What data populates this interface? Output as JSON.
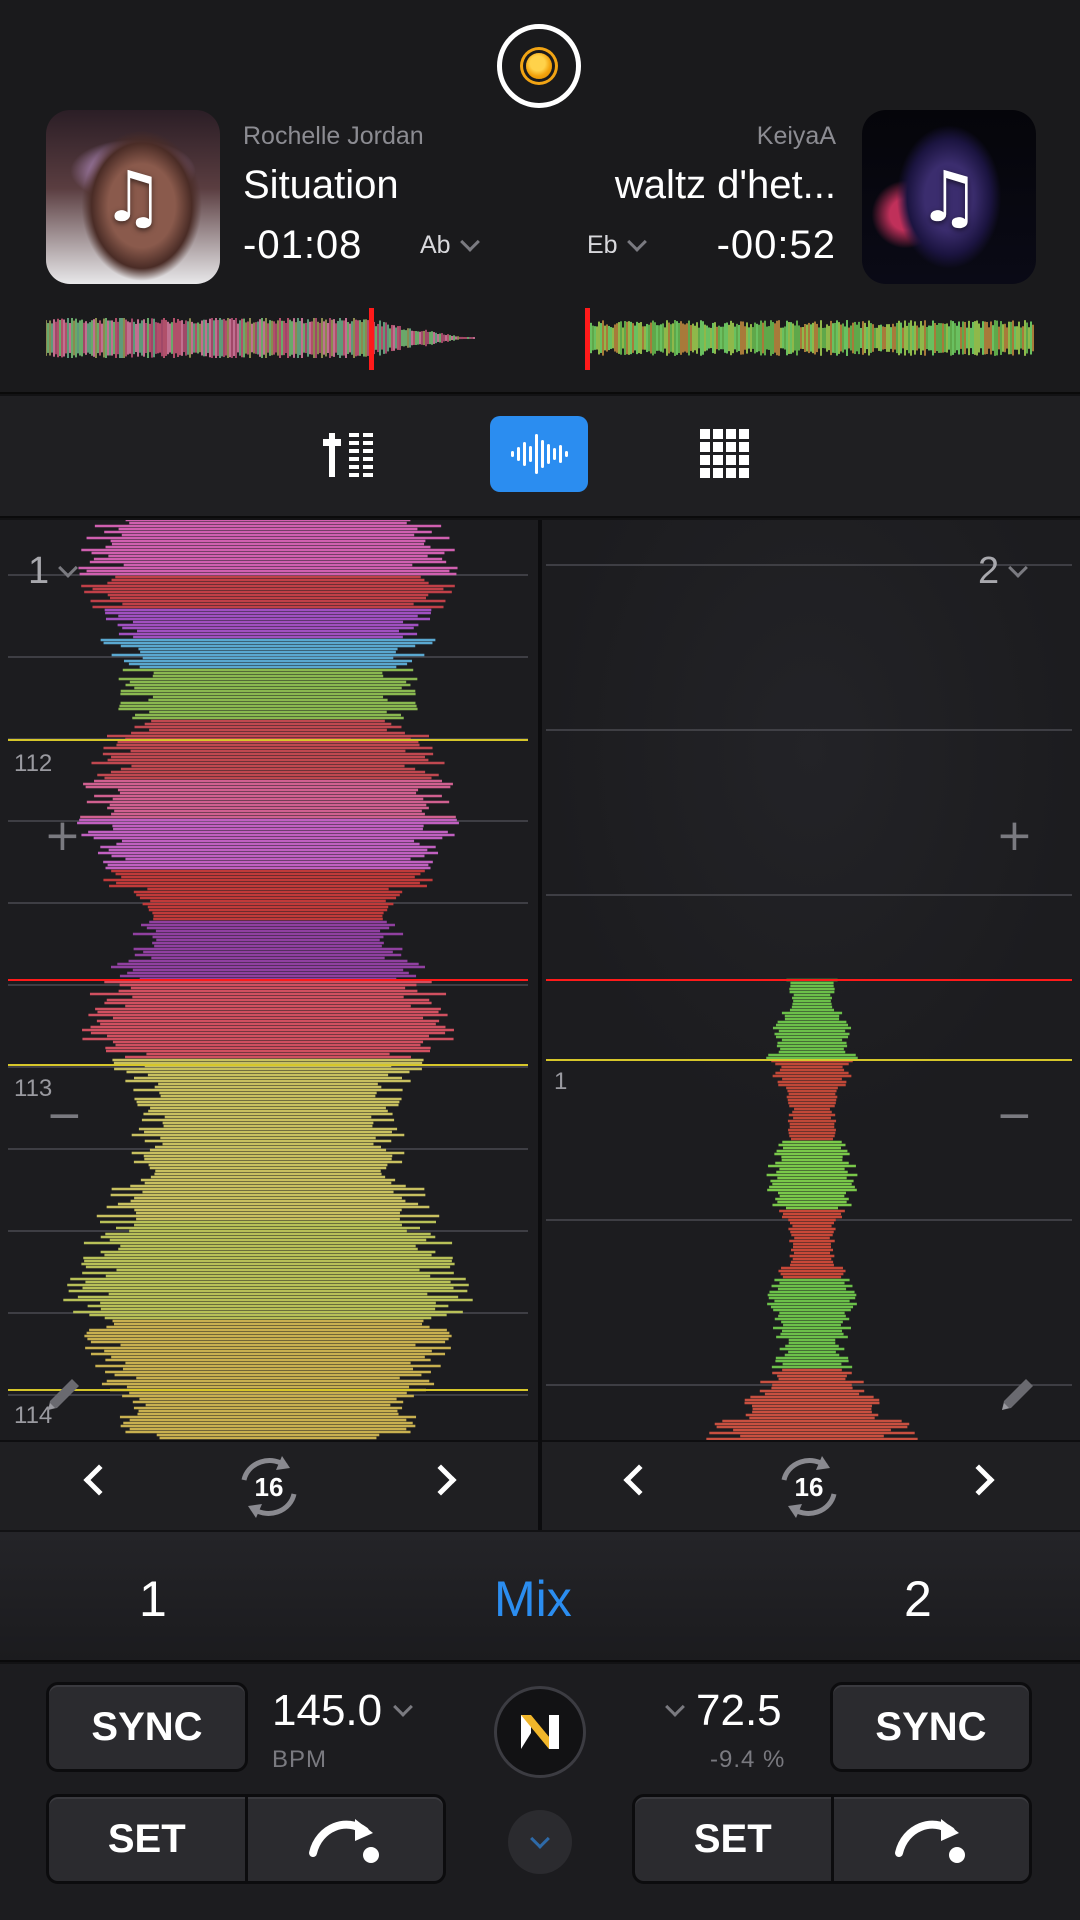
{
  "deck1": {
    "artist": "Rochelle Jordan",
    "title": "Situation",
    "time": "-01:08",
    "key": "Ab",
    "deck_label": "1",
    "bar_labels": [
      "112",
      "113",
      "114"
    ],
    "loop_size": "16",
    "bpm": "145.0",
    "bpm_unit": "BPM",
    "sync_label": "SYNC",
    "set_label": "SET",
    "overview_progress": 0.77
  },
  "deck2": {
    "artist": "KeiyaA",
    "title": "waltz d'het...",
    "time": "-00:52",
    "key": "Eb",
    "deck_label": "2",
    "bar_labels": [
      "1"
    ],
    "loop_size": "16",
    "bpm": "72.5",
    "pitch": "-9.4 %",
    "sync_label": "SYNC",
    "set_label": "SET",
    "overview_progress": 0.0
  },
  "tabs": {
    "left": "1",
    "center": "Mix",
    "right": "2"
  },
  "colors": {
    "accent": "#2b8df0",
    "playhead": "#ff1a1a",
    "beat_line": "#d6c62a",
    "text_dim": "#8c8c92"
  },
  "icons": {
    "app_logo": "rekordbox-disc-icon",
    "mixer": "mixer-faders-icon",
    "waveform": "waveform-icon",
    "pads": "pad-grid-icon",
    "loop": "loop-arrows-icon",
    "cue": "cue-jump-icon",
    "edit": "pencil-icon",
    "navigate": "n-logo-icon"
  }
}
